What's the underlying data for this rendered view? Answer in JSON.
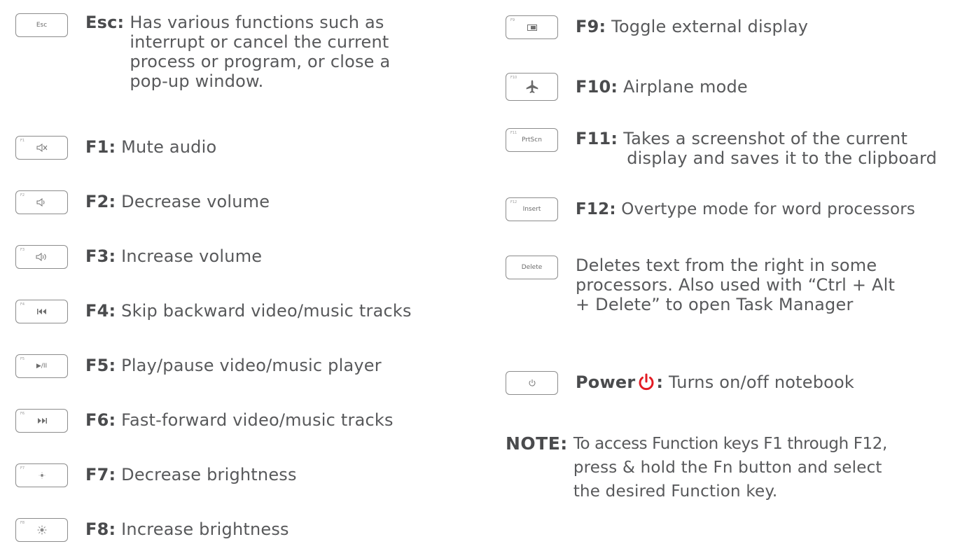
{
  "keys": {
    "esc": {
      "cap": "Esc",
      "label": "Esc:",
      "lines": [
        "Has various functions such as",
        "interrupt or cancel the current",
        "process or program, or close a",
        "pop-up window."
      ]
    },
    "f1": {
      "fn": "F1",
      "icon": "mute-icon",
      "label": "F1:",
      "text": "Mute audio"
    },
    "f2": {
      "fn": "F2",
      "icon": "volume-down-icon",
      "label": "F2:",
      "text": "Decrease volume"
    },
    "f3": {
      "fn": "F3",
      "icon": "volume-up-icon",
      "label": "F3:",
      "text": "Increase volume"
    },
    "f4": {
      "fn": "F4",
      "icon": "skip-backward-icon",
      "label": "F4:",
      "text": "Skip backward video/music tracks"
    },
    "f5": {
      "fn": "F5",
      "icon": "play-pause-icon",
      "cap": "▶/II",
      "label": "F5:",
      "text": "Play/pause video/music player"
    },
    "f6": {
      "fn": "F6",
      "icon": "fast-forward-icon",
      "label": "F6:",
      "text": "Fast-forward video/music tracks"
    },
    "f7": {
      "fn": "F7",
      "icon": "brightness-down-icon",
      "label": "F7:",
      "text": "Decrease brightness"
    },
    "f8": {
      "fn": "F8",
      "icon": "brightness-up-icon",
      "label": "F8:",
      "text": "Increase brightness"
    },
    "f9": {
      "fn": "F9",
      "icon": "external-display-icon",
      "label": "F9:",
      "text": "Toggle external display"
    },
    "f10": {
      "fn": "F10",
      "icon": "airplane-icon",
      "label": "F10:",
      "text": "Airplane mode"
    },
    "f11": {
      "fn": "F11",
      "cap": "PrtScn",
      "label": "F11:",
      "lines": [
        "Takes a screenshot of the current",
        "display and saves it to the clipboard"
      ]
    },
    "f12": {
      "fn": "F12",
      "cap": "Insert",
      "label": "F12:",
      "text": "Overtype mode for word processors"
    },
    "delete": {
      "cap": "Delete",
      "lines": [
        "Deletes text from the right in some",
        "processors. Also used with “Ctrl + Alt",
        "+ Delete” to open Task Manager"
      ]
    },
    "power": {
      "icon": "power-icon",
      "label": "Power",
      "colon": ":",
      "text": "Turns on/off notebook"
    }
  },
  "note": {
    "label": "NOTE:",
    "lines": [
      "To access Function keys F1 through F12,",
      "press & hold the Fn button and select",
      "the desired Function key."
    ]
  },
  "colors": {
    "text": "#58595b",
    "key_border": "#8c8c8c",
    "power_accent": "#e31b23"
  }
}
